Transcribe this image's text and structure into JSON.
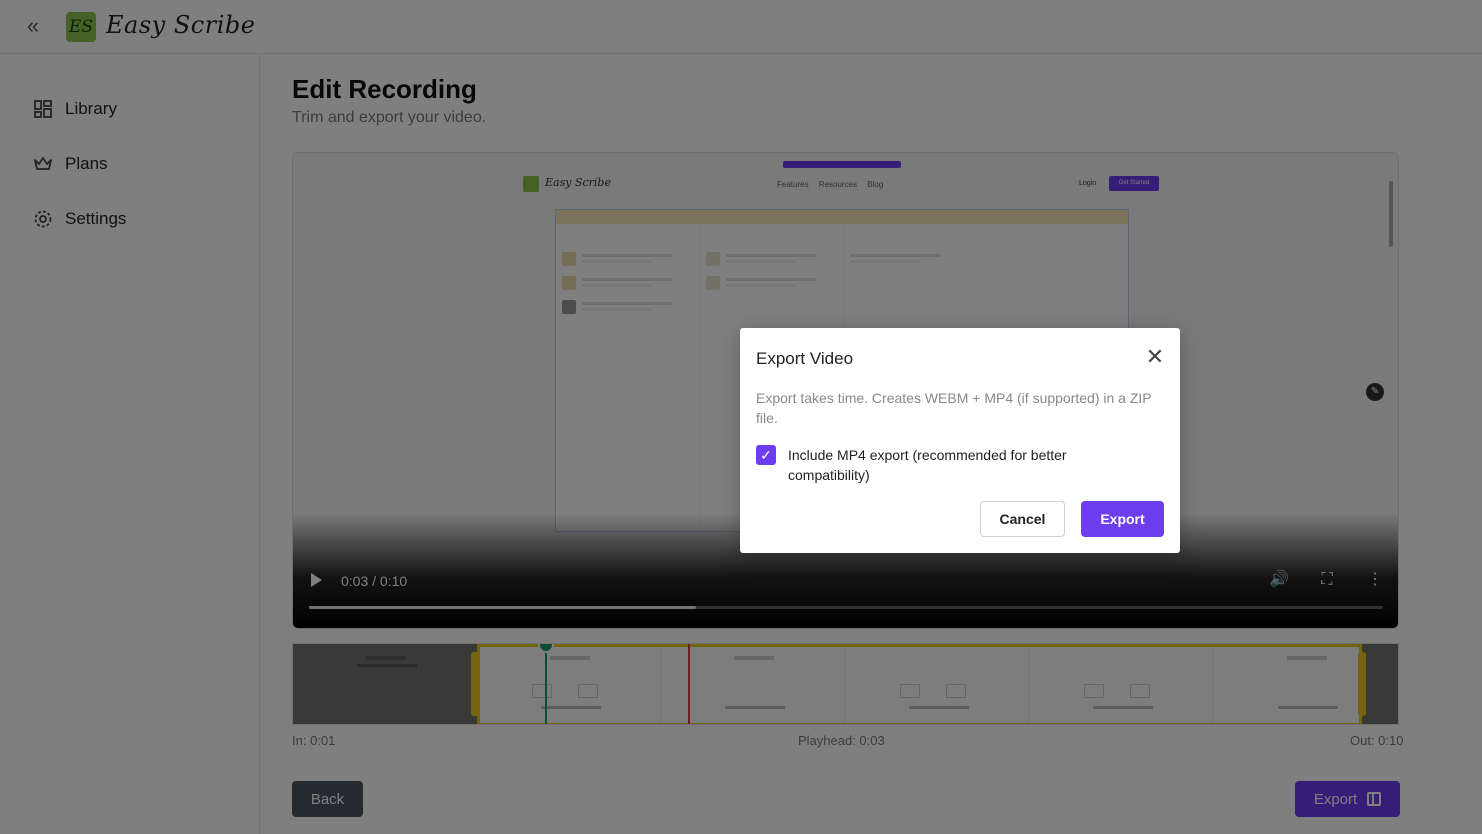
{
  "app": {
    "logo_mark": "ES",
    "logo_text": "Easy Scribe",
    "collapse_icon": "chevrons-left-icon"
  },
  "sidebar": {
    "items": [
      {
        "label": "Library",
        "icon": "dashboard-grid-icon"
      },
      {
        "label": "Plans",
        "icon": "crown-icon"
      },
      {
        "label": "Settings",
        "icon": "gear-icon"
      }
    ]
  },
  "main": {
    "title": "Edit Recording",
    "subtitle": "Trim and export your video."
  },
  "video": {
    "time": "0:03 / 0:10",
    "progress": 0.36,
    "preview": {
      "logo_text": "Easy Scribe",
      "nav_links": "Features Resources Blog",
      "login": "Login",
      "cta": "Get Started"
    }
  },
  "timeline": {
    "in_label": "In: 0:01",
    "playhead_label": "Playhead: 0:03",
    "out_label": "Out: 0:10"
  },
  "actions": {
    "back_label": "Back",
    "export_label": "Export"
  },
  "modal": {
    "title": "Export Video",
    "description": "Export takes time. Creates WEBM + MP4 (if supported) in a ZIP file.",
    "checkbox_label": "Include MP4 export (recommended for better compatibility)",
    "checkbox_checked": true,
    "cancel_label": "Cancel",
    "export_label": "Export"
  },
  "colors": {
    "accent": "#6d3df0",
    "brand_green": "#8bc34a",
    "trim_yellow": "#e9c81f",
    "playhead_red": "#e03a3a",
    "marker_green": "#1f9d6a"
  }
}
